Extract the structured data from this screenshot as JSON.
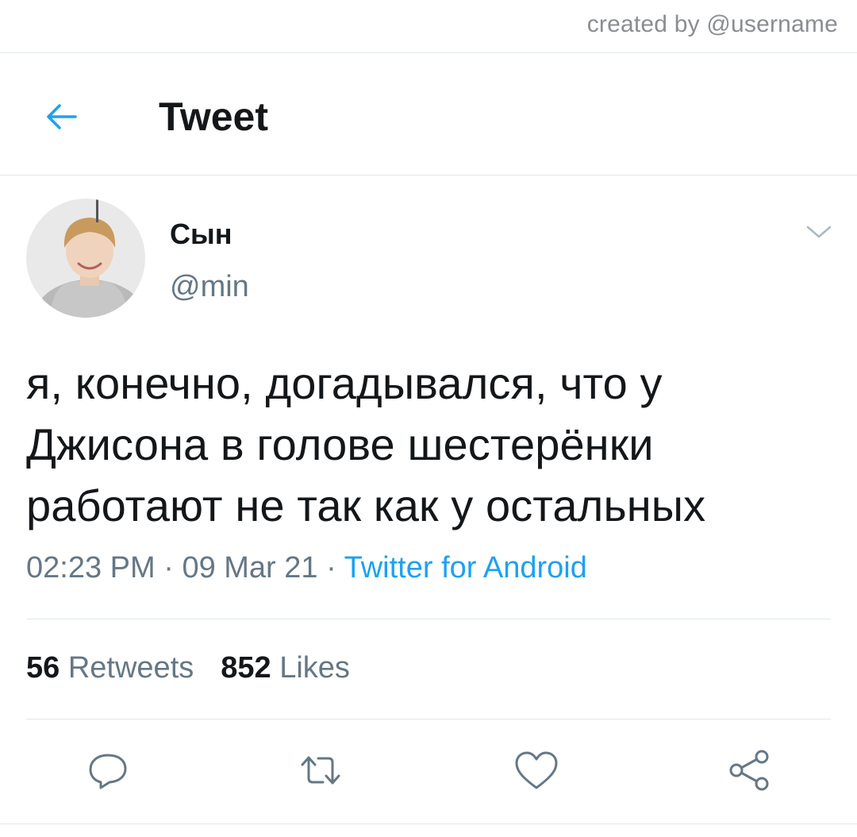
{
  "watermark": "created by @username",
  "header": {
    "title": "Tweet",
    "back_icon": "arrow-left-icon"
  },
  "tweet": {
    "author": {
      "display_name": "Сын",
      "handle": "@min"
    },
    "text": "я, конечно, догадывался, что у Джисона в голове шестерёнки работают не так как у остальных",
    "time": "02:23 PM",
    "date": "09 Mar 21",
    "separator": "·",
    "source": "Twitter for Android",
    "retweets": {
      "count": "56",
      "label": "Retweets"
    },
    "likes": {
      "count": "852",
      "label": "Likes"
    }
  },
  "actions": [
    "reply-icon",
    "retweet-icon",
    "like-icon",
    "share-icon"
  ],
  "colors": {
    "accent": "#1da1f2",
    "secondary_text": "#657786",
    "divider": "#e1e8ed"
  }
}
